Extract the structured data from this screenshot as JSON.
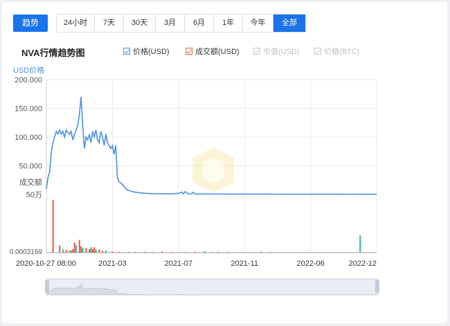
{
  "trend_label": "趋势",
  "ranges": [
    {
      "label": "24小时",
      "w": 55
    },
    {
      "label": "7天",
      "w": 42
    },
    {
      "label": "30天",
      "w": 46
    },
    {
      "label": "3月",
      "w": 42
    },
    {
      "label": "6月",
      "w": 42
    },
    {
      "label": "1年",
      "w": 42
    },
    {
      "label": "今年",
      "w": 44
    },
    {
      "label": "全部",
      "w": 46
    }
  ],
  "active_range": "全部",
  "chart_title": "NVA行情趋势图",
  "legend": [
    {
      "label": "价格(USD)",
      "color": "#4a90e2",
      "enabled": true
    },
    {
      "label": "成交额(USD)",
      "color": "#e8634a",
      "enabled": true
    },
    {
      "label": "市值(USD)",
      "color": "#c8c8c8",
      "enabled": false
    },
    {
      "label": "价格(BTC)",
      "color": "#c8c8c8",
      "enabled": false
    }
  ],
  "chart_data": {
    "type": "line",
    "ylabel": "USD价格",
    "ylabel_volume": "成交额",
    "yticks": [
      "200.000",
      "150.000",
      "100.000",
      "50.000"
    ],
    "volume_ticks": [
      "50万",
      "0.0003169"
    ],
    "ylim": [
      0,
      200
    ],
    "xticks": [
      "2020-10-27 08:00",
      "2021-03",
      "2021-07",
      "2021-11",
      "2022-06",
      "2022-12"
    ],
    "price_series": {
      "name": "价格(USD)",
      "x": [
        0,
        0.005,
        0.01,
        0.015,
        0.02,
        0.025,
        0.03,
        0.035,
        0.04,
        0.045,
        0.05,
        0.055,
        0.06,
        0.065,
        0.07,
        0.075,
        0.08,
        0.085,
        0.09,
        0.095,
        0.1,
        0.105,
        0.11,
        0.115,
        0.12,
        0.125,
        0.13,
        0.135,
        0.14,
        0.145,
        0.15,
        0.155,
        0.16,
        0.165,
        0.17,
        0.175,
        0.18,
        0.185,
        0.19,
        0.195,
        0.2,
        0.205,
        0.21,
        0.215,
        0.22,
        0.225,
        0.23,
        0.235,
        0.24,
        0.245,
        0.25,
        0.255,
        0.26,
        0.265,
        0.27,
        0.28,
        0.29,
        0.3,
        0.32,
        0.34,
        0.36,
        0.38,
        0.4,
        0.41,
        0.415,
        0.42,
        0.43,
        0.44,
        0.445,
        0.45,
        0.46,
        0.5,
        0.55,
        0.6,
        0.7,
        0.8,
        0.9,
        1.0
      ],
      "y": [
        10,
        30,
        40,
        75,
        90,
        100,
        110,
        105,
        112,
        105,
        110,
        100,
        112,
        108,
        105,
        110,
        95,
        105,
        112,
        120,
        140,
        170,
        120,
        80,
        100,
        95,
        105,
        90,
        110,
        100,
        112,
        95,
        90,
        110,
        100,
        85,
        105,
        90,
        85,
        80,
        85,
        70,
        85,
        30,
        22,
        20,
        18,
        14,
        10,
        8,
        7,
        6,
        5,
        4.5,
        4,
        3,
        2.5,
        2,
        1.5,
        1.2,
        1.5,
        1.2,
        2,
        4,
        1,
        5,
        1,
        1.2,
        4,
        1,
        0.8,
        0.8,
        0.7,
        0.7,
        0.6,
        0.5,
        0.5,
        0.4
      ]
    },
    "volume_series": {
      "name": "成交额(USD)",
      "x": [
        0.02,
        0.04,
        0.05,
        0.06,
        0.07,
        0.075,
        0.08,
        0.085,
        0.09,
        0.1,
        0.105,
        0.11,
        0.12,
        0.13,
        0.135,
        0.14,
        0.145,
        0.15,
        0.16,
        0.17,
        0.18,
        0.2,
        0.22,
        0.25,
        0.27,
        0.3,
        0.32,
        0.35,
        0.38,
        0.4,
        0.42,
        0.45,
        0.48,
        0.5,
        0.52,
        0.55,
        0.58,
        0.6,
        0.62,
        0.65,
        0.68,
        0.7,
        0.72,
        0.75,
        0.8,
        0.85,
        0.9,
        0.95,
        0.98
      ],
      "values": [
        290,
        40,
        20,
        15,
        10,
        12,
        20,
        55,
        40,
        70,
        35,
        25,
        25,
        20,
        30,
        20,
        30,
        15,
        18,
        10,
        12,
        6,
        4,
        4,
        5,
        5,
        4,
        6,
        3,
        3,
        3,
        4,
        8,
        3,
        4,
        4,
        2,
        2,
        3,
        4,
        3,
        2,
        2,
        2,
        1,
        1,
        1,
        95,
        1
      ],
      "series_colors": [
        "#e8634a",
        "#3bbf9a"
      ]
    },
    "grid": true
  }
}
